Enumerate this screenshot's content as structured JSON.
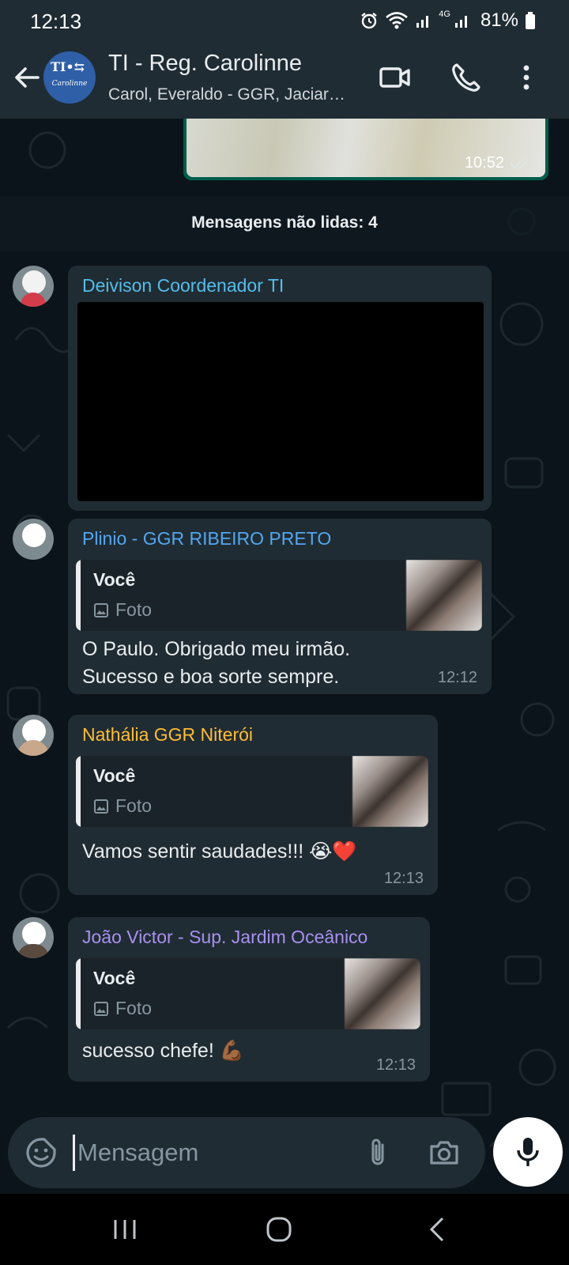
{
  "status_bar": {
    "time": "12:13",
    "network_label": "4G",
    "battery": "81%"
  },
  "header": {
    "title": "TI - Reg. Carolinne",
    "subtitle": "Carol, Everaldo - GGR, Jaciar…",
    "avatar_logo_top": "TI•⇆",
    "avatar_logo_bottom": "Carolinne"
  },
  "chat": {
    "outgoing_media_time": "10:52",
    "unread_banner": "Mensagens não lidas: 4",
    "messages": [
      {
        "sender": "Deivison Coordenador TI",
        "sender_color": "#53bdeb"
      },
      {
        "sender": "Plinio - GGR RIBEIRO PRETO",
        "sender_color": "#53a6f0",
        "quote_name": "Você",
        "quote_type": "Foto",
        "text_lines": [
          "O Paulo. Obrigado meu irmão.",
          "Sucesso e boa sorte sempre."
        ],
        "time": "12:12"
      },
      {
        "sender": "Nathália GGR Niterói",
        "sender_color": "#ffbc38",
        "quote_name": "Você",
        "quote_type": "Foto",
        "text": "Vamos sentir saudades!!! 😭❤️",
        "time": "12:13"
      },
      {
        "sender": "João Victor - Sup. Jardim Oceânico",
        "sender_color": "#a791f0",
        "quote_name": "Você",
        "quote_type": "Foto",
        "text": "sucesso chefe! 💪🏾",
        "time": "12:13"
      }
    ]
  },
  "composer": {
    "placeholder": "Mensagem"
  },
  "colors": {
    "header_bg": "#1f2c34",
    "chat_bg": "#0b141a",
    "incoming_bubble": "#202c33",
    "outgoing_bubble": "#005c4b"
  },
  "icons": [
    "back-arrow-icon",
    "video-call-icon",
    "phone-icon",
    "more-options-icon",
    "sticker-icon",
    "attach-icon",
    "camera-icon",
    "mic-icon",
    "image-icon",
    "double-check-icon"
  ]
}
